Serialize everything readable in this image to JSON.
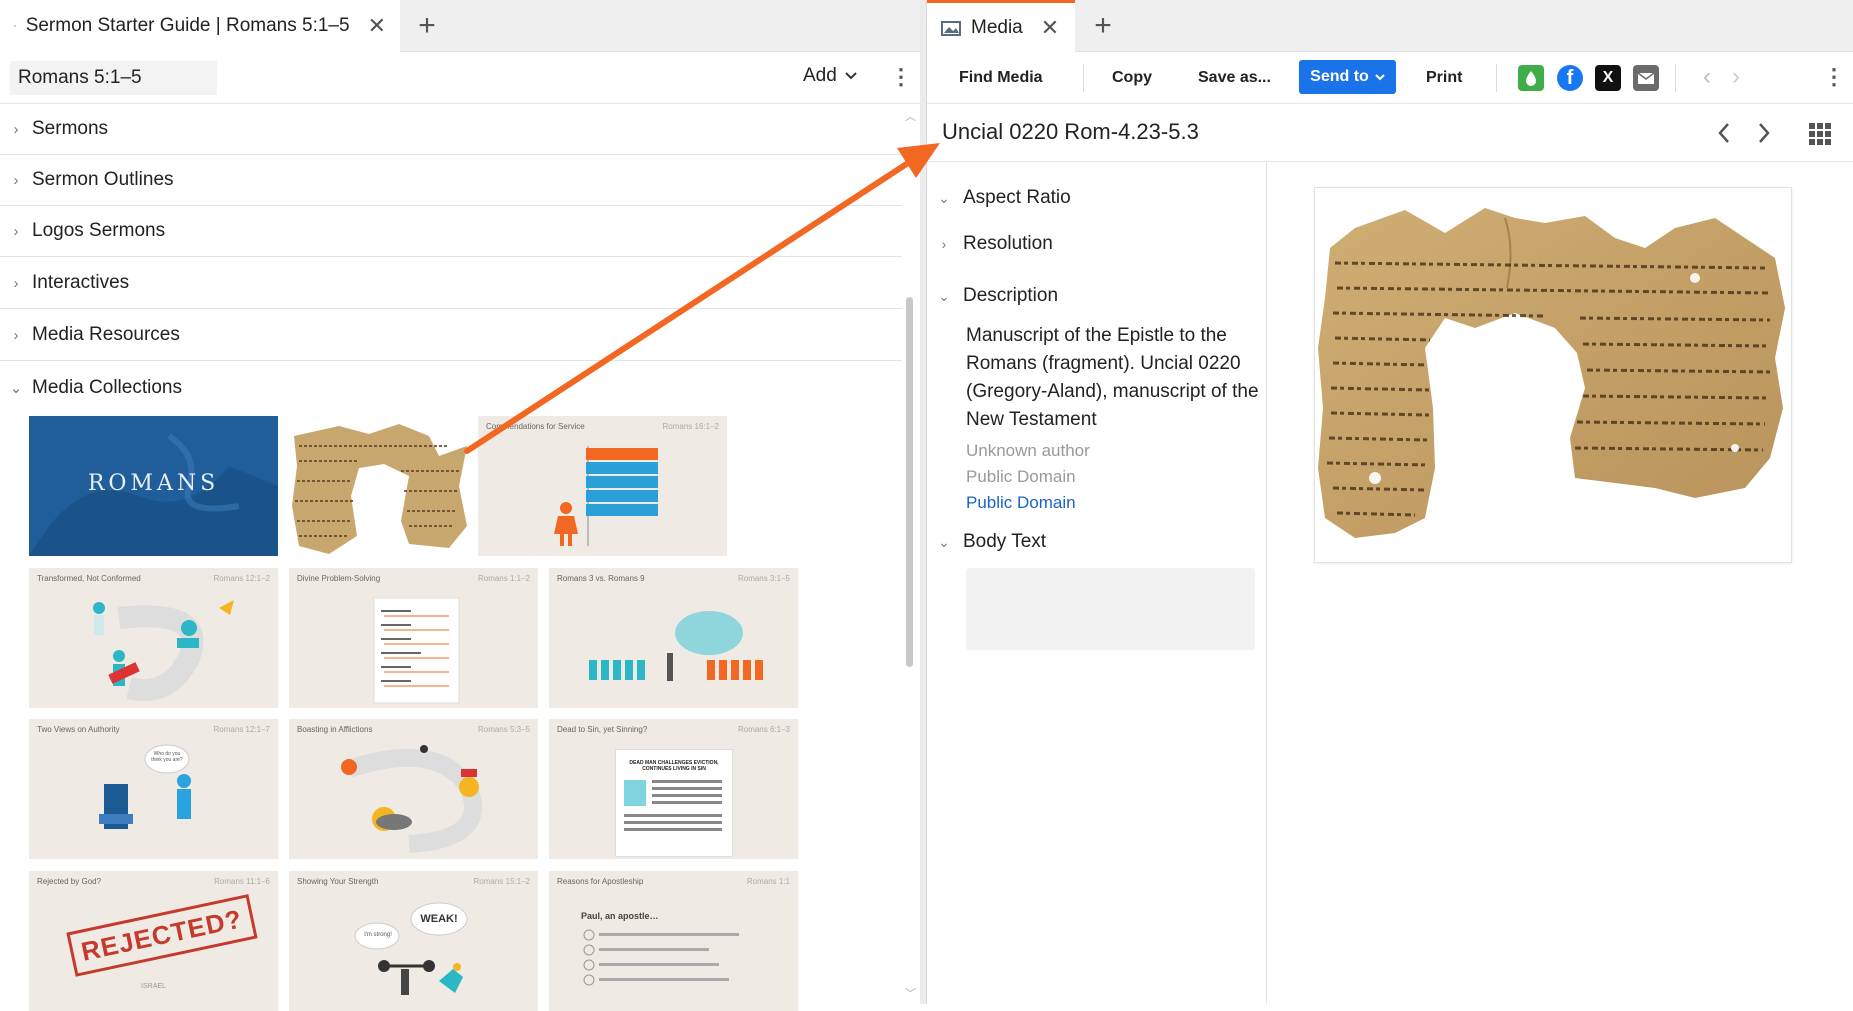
{
  "left_tab": {
    "title": "Sermon Starter Guide | Romans 5:1–5",
    "close": "✕",
    "new": "+"
  },
  "left_toolbar": {
    "reference": "Romans 5:1–5",
    "add_label": "Add"
  },
  "sections": [
    {
      "label": "Sermons",
      "expanded": false
    },
    {
      "label": "Sermon Outlines",
      "expanded": false
    },
    {
      "label": "Logos Sermons",
      "expanded": false
    },
    {
      "label": "Interactives",
      "expanded": false
    },
    {
      "label": "Media Resources",
      "expanded": false
    },
    {
      "label": "Media Collections",
      "expanded": true
    }
  ],
  "thumbnails": [
    {
      "title": "ROMANS",
      "ref": ""
    },
    {
      "title": "",
      "ref": ""
    },
    {
      "title": "Commendations for Service",
      "ref": "Romans 16:1–2"
    },
    {
      "title": "Transformed, Not Conformed",
      "ref": "Romans 12:1–2"
    },
    {
      "title": "Divine Problem-Solving",
      "ref": "Romans 1:1–2"
    },
    {
      "title": "Romans 3 vs. Romans 9",
      "ref": "Romans 3:1–5"
    },
    {
      "title": "Two Views on Authority",
      "ref": "Romans 12:1–7"
    },
    {
      "title": "Boasting in Afflictions",
      "ref": "Romans 5:3–5"
    },
    {
      "title": "Dead to Sin, yet Sinning?",
      "ref": "Romans 6:1–3"
    },
    {
      "title": "Rejected by God?",
      "ref": "Romans 11:1–6"
    },
    {
      "title": "Showing Your Strength",
      "ref": "Romans 15:1–2"
    },
    {
      "title": "Reasons for Apostleship",
      "ref": "Romans 1:1"
    }
  ],
  "thumb_text": {
    "rejected": "REJECTED?",
    "israel": "ISRAEL",
    "weak": "WEAK!",
    "strong": "I'm strong!",
    "dead_man": "DEAD MAN CHALLENGES EVICTION, CONTINUES LIVING IN SIN",
    "paul": "Paul, an apostle…",
    "who": "Who do you think you are?"
  },
  "right_tab": {
    "title": "Media",
    "close": "✕",
    "new": "+"
  },
  "right_toolbar": {
    "find_media": "Find Media",
    "copy": "Copy",
    "save_as": "Save as...",
    "send_to": "Send to",
    "print": "Print"
  },
  "media": {
    "title": "Uncial 0220 Rom-4.23-5.3",
    "aspect_ratio": "Aspect Ratio",
    "resolution": "Resolution",
    "description_label": "Description",
    "description": "Manuscript of the Epistle to the Romans (fragment). Uncial 0220 (Gregory-Aland), manuscript of the New Testament",
    "author": "Unknown author",
    "license": "Public Domain",
    "license_link": "Public Domain",
    "body_text_label": "Body Text"
  },
  "colors": {
    "accent_blue": "#1a73e8",
    "arrow_orange": "#f26722",
    "link_blue": "#1a64c8",
    "romans_blue": "#1c5a93"
  },
  "icons": {
    "facebook": "facebook-icon",
    "x": "x-icon",
    "email": "email-icon",
    "logos": "logos-icon"
  }
}
